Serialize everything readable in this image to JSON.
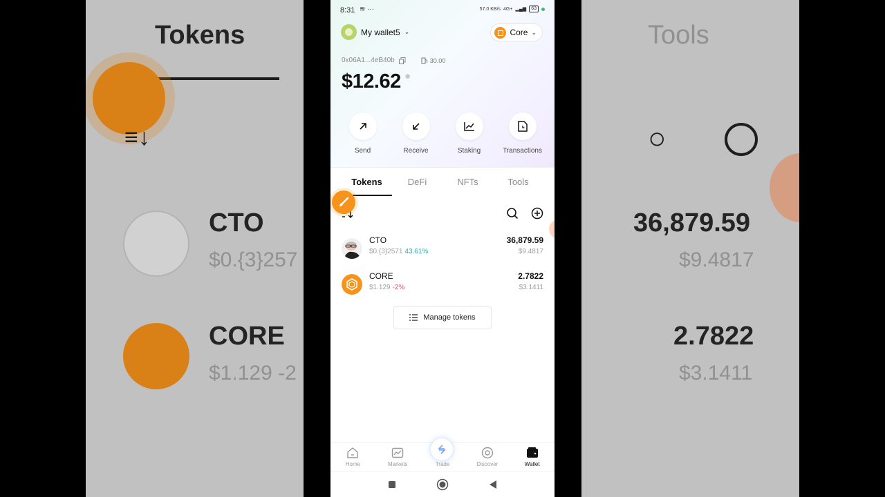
{
  "background_left": {
    "title": "Tokens",
    "token1_symbol": "CTO",
    "token1_sub": "$0.{3}257",
    "token2_symbol": "CORE",
    "token2_sub": "$1.129 -2"
  },
  "background_right": {
    "title": "Tools",
    "token1_amount": "36,879.59",
    "token1_value": "$9.4817",
    "token2_amount": "2.7822",
    "token2_value": "$3.1411"
  },
  "status_bar": {
    "time": "8:31",
    "net_speed": "57.0 KB/s",
    "network": "4G+",
    "battery": "63"
  },
  "header": {
    "wallet_name": "My wallet5",
    "chain_name": "Core"
  },
  "account": {
    "address": "0x06A1...4eB40b",
    "gas": "30.00",
    "balance": "$12.62"
  },
  "actions": [
    {
      "label": "Send",
      "icon": "arrow-up-right-icon"
    },
    {
      "label": "Receive",
      "icon": "arrow-down-left-icon"
    },
    {
      "label": "Staking",
      "icon": "chart-icon"
    },
    {
      "label": "Transactions",
      "icon": "document-clock-icon"
    }
  ],
  "tabs": [
    {
      "label": "Tokens",
      "active": true
    },
    {
      "label": "DeFi",
      "active": false
    },
    {
      "label": "NFTs",
      "active": false
    },
    {
      "label": "Tools",
      "active": false
    }
  ],
  "tokens": [
    {
      "symbol": "CTO",
      "price": "$0.{3}2571",
      "change": "43.61%",
      "change_dir": "up",
      "amount": "36,879.59",
      "value": "$9.4817"
    },
    {
      "symbol": "CORE",
      "price": "$1.129",
      "change": "-2%",
      "change_dir": "down",
      "amount": "2.7822",
      "value": "$3.1411"
    }
  ],
  "manage_label": "Manage tokens",
  "bottom_nav": [
    {
      "label": "Home",
      "icon": "home-icon",
      "active": false
    },
    {
      "label": "Markets",
      "icon": "markets-icon",
      "active": false
    },
    {
      "label": "Trade",
      "icon": "trade-icon",
      "active": false
    },
    {
      "label": "Discover",
      "icon": "discover-icon",
      "active": false
    },
    {
      "label": "Wallet",
      "icon": "wallet-icon",
      "active": true
    }
  ],
  "colors": {
    "accent": "#f7931a",
    "positive": "#1fb3b3",
    "negative": "#f0506e"
  }
}
